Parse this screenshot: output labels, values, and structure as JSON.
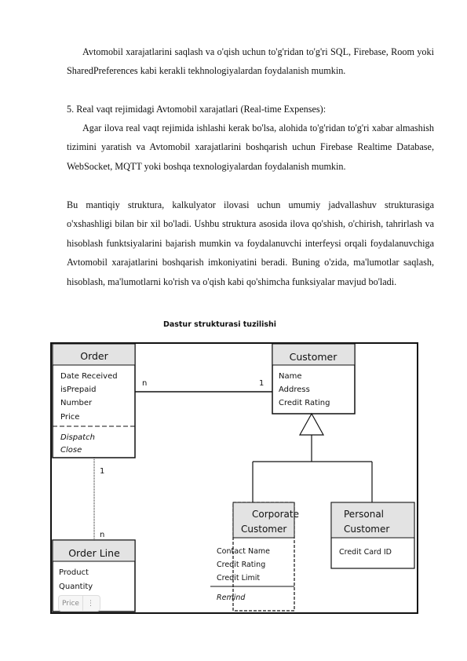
{
  "paragraphs": [
    "Avtomobil xarajatlarini saqlash va o'qish uchun to'g'ridan to'g'ri SQL, Firebase, Room yoki SharedPreferences kabi kerakli tekhnologiyalardan foydalanish mumkin.",
    "5. Real vaqt rejimidagi Avtomobil xarajatlari (Real-time Expenses):",
    "Agar ilova real vaqt rejimida ishlashi kerak bo'lsa, alohida to'g'ridan to'g'ri xabar almashish tizimini yaratish va Avtomobil xarajatlarini boshqarish uchun Firebase Realtime Database, WebSocket, MQTT yoki boshqa texnologiyalardan foydalanish mumkin.",
    "Bu mantiqiy struktura, kalkulyator ilovasi uchun umumiy jadvallashuv strukturasiga o'xshashligi bilan bir xil bo'ladi. Ushbu struktura asosida ilova qo'shish, o'chirish, tahrirlash va hisoblash funktsiyalarini bajarish mumkin va foydalanuvchi interfeysi orqali foydalanuvchiga Avtomobil xarajatlarini boshqarish imkoniyatini beradi. Buning o'zida, ma'lumotlar saqlash, hisoblash, ma'lumotlarni ko'rish va o'qish kabi qo'shimcha funksiyalar mavjud bo'ladi."
  ],
  "diagram": {
    "caption": "Dastur strukturasi tuzilishi",
    "order": {
      "title": "Order",
      "attrs": [
        "Date Received",
        "isPrepaid",
        "Number",
        "Price"
      ],
      "ops": [
        "Dispatch",
        "Close"
      ]
    },
    "customer": {
      "title": "Customer",
      "attrs": [
        "Name",
        "Address",
        "Credit Rating"
      ]
    },
    "corporate": {
      "title": [
        "Corporate",
        "Customer"
      ],
      "attrs": [
        "Contact Name",
        "Credit Rating",
        "Credit Limit"
      ],
      "ops": [
        "Remind"
      ]
    },
    "personal": {
      "title": [
        "Personal",
        "Customer"
      ],
      "attrs": [
        "Credit Card ID"
      ]
    },
    "order_line": {
      "title": "Order Line",
      "attrs": [
        "Product",
        "Quantity"
      ]
    },
    "multiplicity": {
      "order_customer_n": "n",
      "order_customer_1": "1",
      "order_line_1": "1",
      "order_line_n": "n"
    },
    "overlay_chip": {
      "label": "Price",
      "menu": "⋮"
    }
  },
  "colors": {
    "header_fill": "#e3e3e3",
    "line": "#111111"
  }
}
